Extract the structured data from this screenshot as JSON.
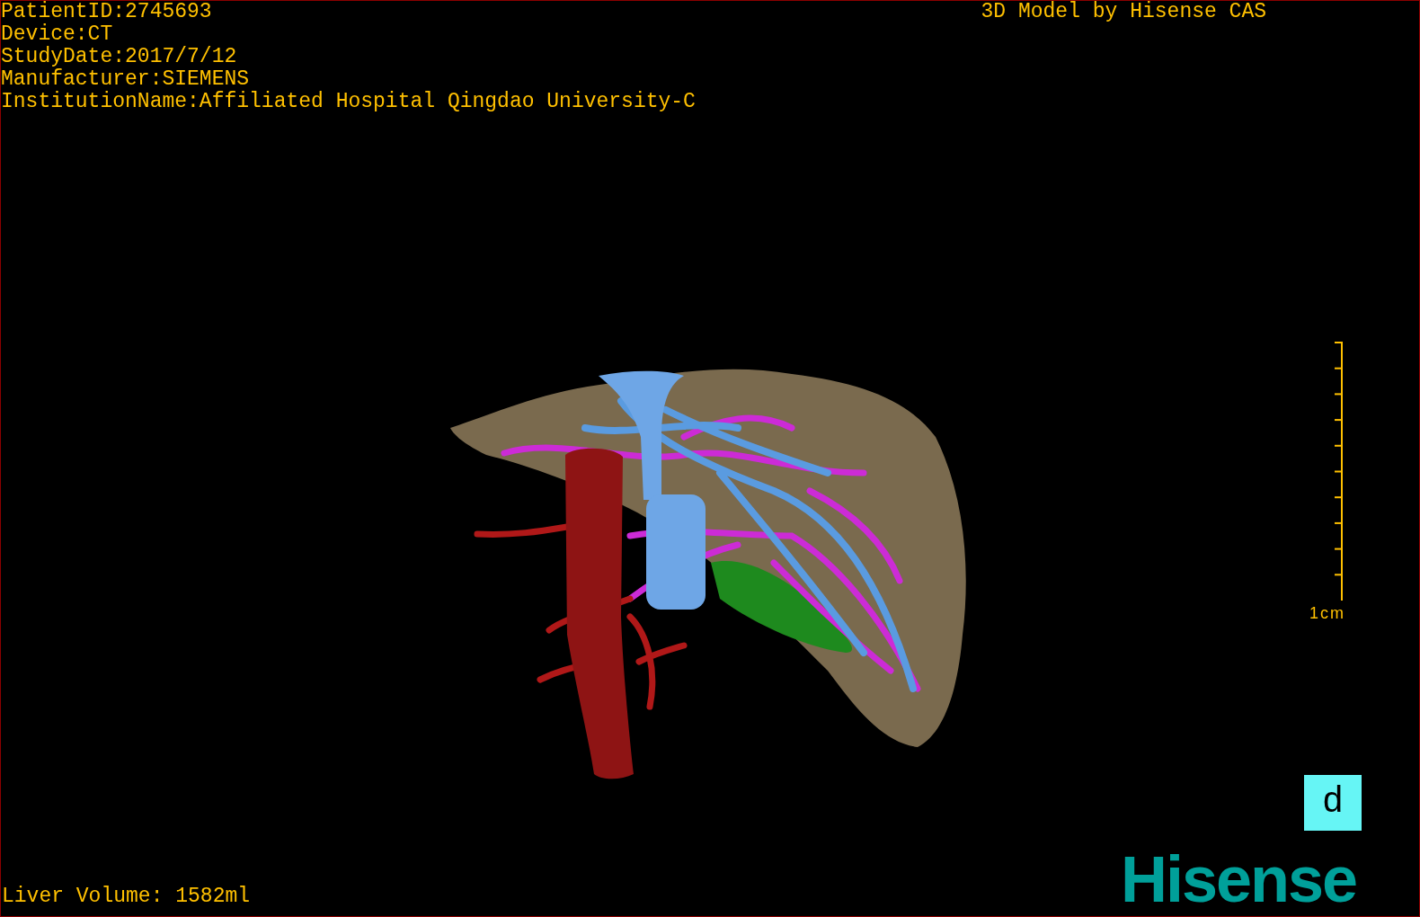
{
  "header": {
    "lines": [
      "PatientID:2745693",
      "Device:CT",
      "StudyDate:2017/7/12",
      "Manufacturer:SIEMENS",
      "InstitutionName:Affiliated Hospital Qingdao University-C"
    ],
    "credit": "3D Model by Hisense CAS"
  },
  "scale_bar": {
    "label": "1cm"
  },
  "orientation_marker": {
    "label": "d"
  },
  "footer": {
    "volume": "Liver Volume: 1582ml",
    "logo": "Hisense"
  }
}
